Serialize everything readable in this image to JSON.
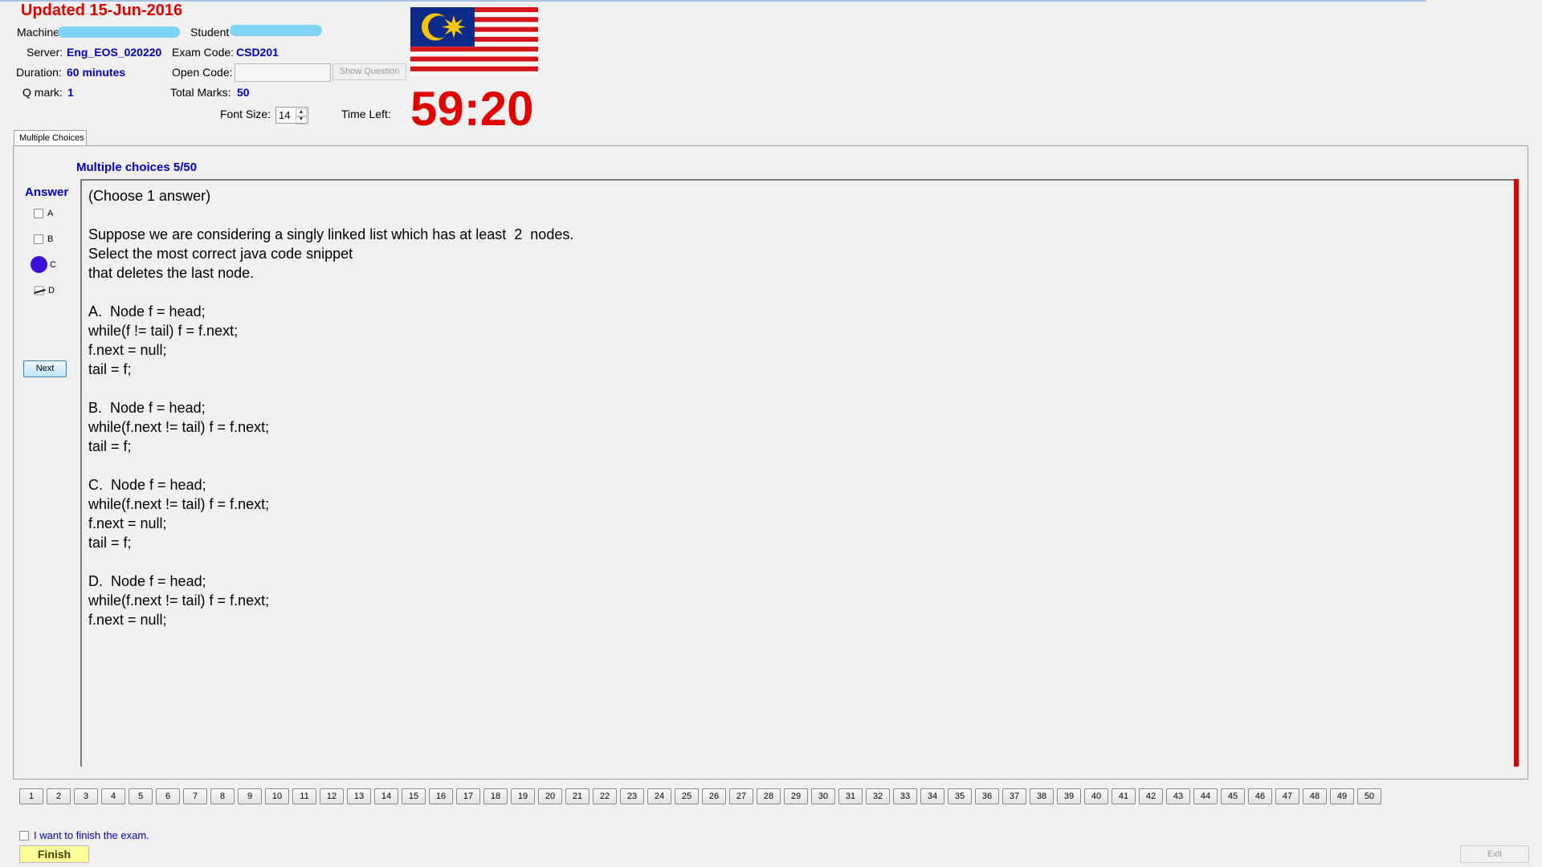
{
  "header": {
    "updated": "Updated 15-Jun-2016",
    "machine_label": "Machine",
    "student_label": "Student",
    "server_label": "Server:",
    "server_value": "Eng_EOS_020220",
    "exam_code_label": "Exam Code:",
    "exam_code_value": "CSD201",
    "duration_label": "Duration:",
    "duration_value": "60 minutes",
    "open_code_label": "Open Code:",
    "show_question_button": "Show Question",
    "qmark_label": "Q mark:",
    "qmark_value": "1",
    "total_marks_label": "Total Marks:",
    "total_marks_value": "50",
    "font_size_label": "Font Size:",
    "font_size_value": "14",
    "time_left_label": "Time Left:",
    "timer": "59:20"
  },
  "tab": {
    "label": "Multiple Choices"
  },
  "question": {
    "header": "Multiple choices 5/50",
    "text": "(Choose 1 answer)\n\nSuppose we are considering a singly linked list which has at least  2  nodes.\nSelect the most correct java code snippet\nthat deletes the last node.\n\nA.  Node f = head;\nwhile(f != tail) f = f.next;\nf.next = null;\ntail = f;\n\nB.  Node f = head;\nwhile(f.next != tail) f = f.next;\ntail = f;\n\nC.  Node f = head;\nwhile(f.next != tail) f = f.next;\nf.next = null;\ntail = f;\n\nD.  Node f = head;\nwhile(f.next != tail) f = f.next;\nf.next = null;"
  },
  "answer": {
    "label": "Answer",
    "options": [
      "A",
      "B",
      "C",
      "D"
    ],
    "selected": "C"
  },
  "next_button": "Next",
  "question_numbers": [
    "1",
    "2",
    "3",
    "4",
    "5",
    "6",
    "7",
    "8",
    "9",
    "10",
    "11",
    "12",
    "13",
    "14",
    "15",
    "16",
    "17",
    "18",
    "19",
    "20",
    "21",
    "22",
    "23",
    "24",
    "25",
    "26",
    "27",
    "28",
    "29",
    "30",
    "31",
    "32",
    "33",
    "34",
    "35",
    "36",
    "37",
    "38",
    "39",
    "40",
    "41",
    "42",
    "43",
    "44",
    "45",
    "46",
    "47",
    "48",
    "49",
    "50"
  ],
  "footer": {
    "finish_checkbox_label": "I want to finish the exam.",
    "finish_button": "Finish",
    "exit_button": "Exit"
  },
  "colors": {
    "accent_blue": "#0000c0",
    "timer_red": "#e00000",
    "selected_radio": "#3a10d8",
    "finish_yellow": "#ffff99"
  }
}
